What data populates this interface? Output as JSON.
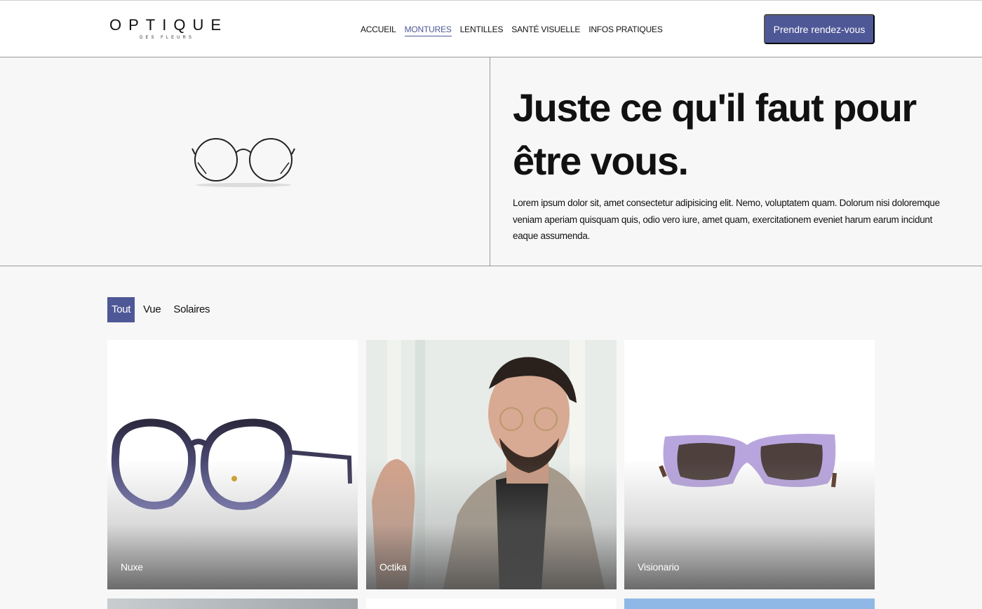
{
  "header": {
    "logo_main": "OPTIQUE",
    "logo_sub": "DES FLEURS",
    "nav": [
      {
        "label": "ACCUEIL",
        "active": false
      },
      {
        "label": "MONTURES",
        "active": true
      },
      {
        "label": "LENTILLES",
        "active": false
      },
      {
        "label": "SANTÉ VISUELLE",
        "active": false
      },
      {
        "label": "INFOS PRATIQUES",
        "active": false
      }
    ],
    "cta_label": "Prendre rendez-vous"
  },
  "hero": {
    "title": "Juste ce qu'il faut pour être vous.",
    "text": "Lorem ipsum dolor sit, amet consectetur adipisicing elit. Nemo, voluptatem quam. Dolorum nisi doloremque veniam aperiam quisquam quis, odio vero iure, amet quam, exercitationem eveniet harum earum incidunt eaque assumenda.",
    "image_icon": "round-glasses-icon"
  },
  "filters": [
    {
      "label": "Tout",
      "active": true
    },
    {
      "label": "Vue",
      "active": false
    },
    {
      "label": "Solaires",
      "active": false
    }
  ],
  "products": [
    {
      "name": "Nuxe",
      "image": "purple-round-glasses"
    },
    {
      "name": "Octika",
      "image": "man-wearing-glasses"
    },
    {
      "name": "Visionario",
      "image": "lilac-sunglasses"
    }
  ],
  "colors": {
    "accent": "#4f5897",
    "background": "#f7f7f7"
  }
}
